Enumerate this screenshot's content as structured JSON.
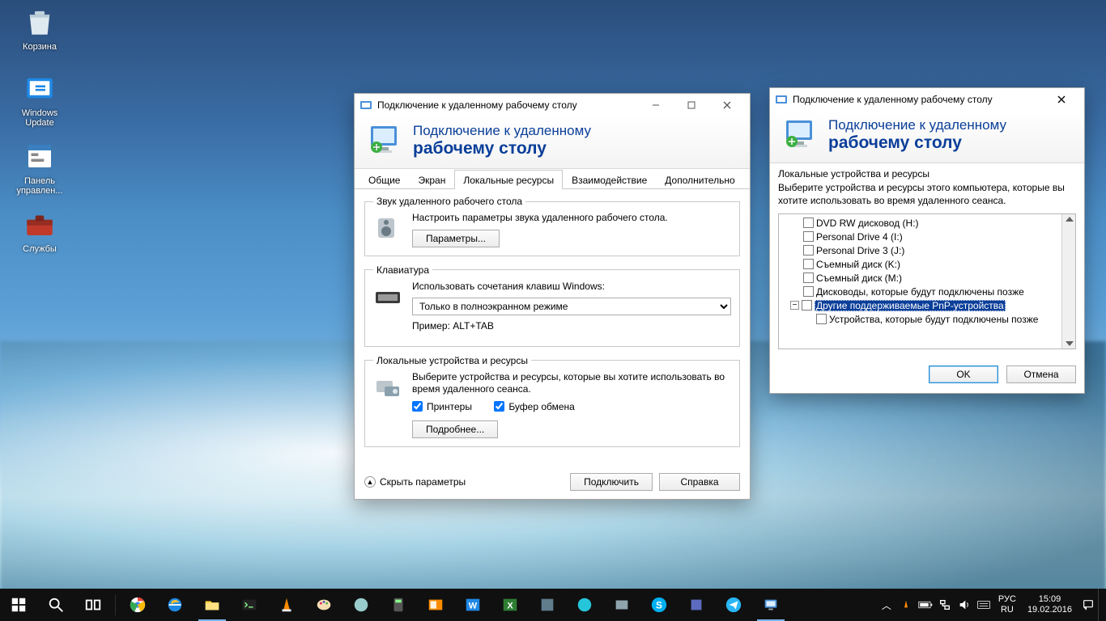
{
  "desktop": {
    "recycle_bin": "Корзина",
    "windows_update": "Windows Update",
    "control_panel": "Панель управлен...",
    "services": "Службы"
  },
  "rdc_main": {
    "title": "Подключение к удаленному рабочему столу",
    "header_line1": "Подключение к удаленному",
    "header_line2": "рабочему столу",
    "tabs": {
      "general": "Общие",
      "display": "Экран",
      "local": "Локальные ресурсы",
      "experience": "Взаимодействие",
      "advanced": "Дополнительно"
    },
    "audio": {
      "legend": "Звук удаленного рабочего стола",
      "desc": "Настроить параметры звука удаленного рабочего стола.",
      "button": "Параметры..."
    },
    "keyboard": {
      "legend": "Клавиатура",
      "desc": "Использовать сочетания клавиш Windows:",
      "combo_value": "Только в полноэкранном режиме",
      "example": "Пример: ALT+TAB"
    },
    "localres": {
      "legend": "Локальные устройства и ресурсы",
      "desc": "Выберите устройства и ресурсы, которые вы хотите использовать во время удаленного сеанса.",
      "printers": "Принтеры",
      "clipboard": "Буфер обмена",
      "more": "Подробнее..."
    },
    "footer": {
      "hide": "Скрыть параметры",
      "connect": "Подключить",
      "help": "Справка"
    }
  },
  "rdc_devices": {
    "title": "Подключение к удаленному рабочему столу",
    "header_line1": "Подключение к удаленному",
    "header_line2": "рабочему столу",
    "section_label": "Локальные устройства и ресурсы",
    "section_desc": "Выберите устройства и ресурсы этого компьютера, которые вы хотите использовать во время удаленного сеанса.",
    "tree": {
      "items": [
        "DVD RW дисковод (H:)",
        "Personal Drive 4 (I:)",
        "Personal Drive 3 (J:)",
        "Съемный диск (K:)",
        "Съемный диск (M:)",
        "Дисководы, которые будут подключены позже"
      ],
      "selected": "Другие поддерживаемые PnP-устройства",
      "child": "Устройства, которые будут подключены позже"
    },
    "buttons": {
      "ok": "OK",
      "cancel": "Отмена"
    }
  },
  "taskbar": {
    "lang1": "РУС",
    "lang2": "RU",
    "time": "15:09",
    "date": "19.02.2016"
  }
}
